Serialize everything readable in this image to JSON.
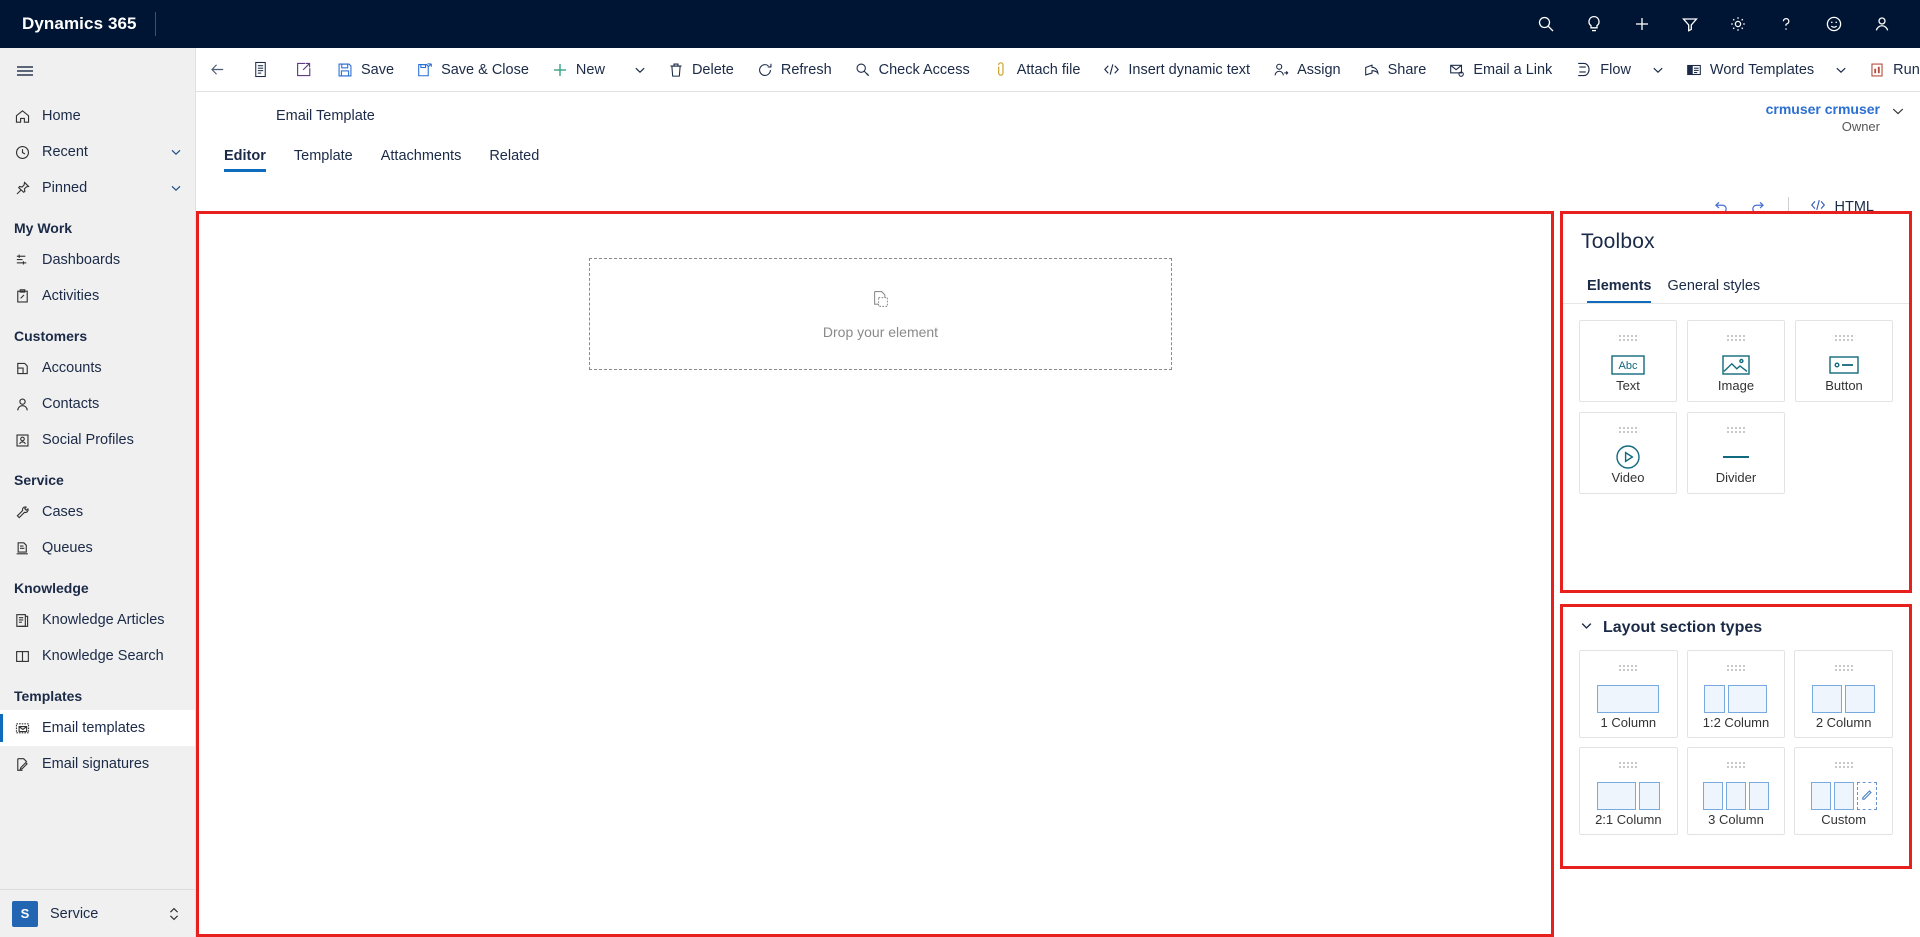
{
  "topbar": {
    "brand": "Dynamics 365",
    "icons": [
      {
        "name": "search-icon",
        "label": "Search"
      },
      {
        "name": "lightbulb-icon",
        "label": "Tips"
      },
      {
        "name": "plus-icon",
        "label": "New"
      },
      {
        "name": "filter-icon",
        "label": "Filter"
      },
      {
        "name": "gear-icon",
        "label": "Settings"
      },
      {
        "name": "question-icon",
        "label": "Help"
      },
      {
        "name": "smiley-icon",
        "label": "Feedback"
      },
      {
        "name": "person-icon",
        "label": "Account"
      }
    ]
  },
  "commandbar": {
    "items": [
      {
        "name": "back-button",
        "label": "",
        "icon": "arrow-left-icon"
      },
      {
        "name": "form-selector-button",
        "label": "",
        "icon": "form-icon"
      },
      {
        "name": "open-new-window-button",
        "label": "",
        "icon": "open-external-icon"
      },
      {
        "name": "save-button",
        "label": "Save",
        "icon": "save-icon"
      },
      {
        "name": "save-and-close-button",
        "label": "Save & Close",
        "icon": "save-close-icon"
      },
      {
        "name": "new-button",
        "label": "New",
        "icon": "plus-icon"
      },
      {
        "name": "new-overflow-caret",
        "label": "",
        "icon": "chevron-down-icon"
      },
      {
        "name": "delete-button",
        "label": "Delete",
        "icon": "trash-icon"
      },
      {
        "name": "refresh-button",
        "label": "Refresh",
        "icon": "refresh-icon"
      },
      {
        "name": "check-access-button",
        "label": "Check Access",
        "icon": "key-icon"
      },
      {
        "name": "attach-file-button",
        "label": "Attach file",
        "icon": "paperclip-icon"
      },
      {
        "name": "insert-dynamic-text-button",
        "label": "Insert dynamic text",
        "icon": "code-icon"
      },
      {
        "name": "assign-button",
        "label": "Assign",
        "icon": "assign-person-icon"
      },
      {
        "name": "share-button",
        "label": "Share",
        "icon": "share-icon"
      },
      {
        "name": "email-a-link-button",
        "label": "Email a Link",
        "icon": "email-link-icon"
      },
      {
        "name": "flow-button",
        "label": "Flow",
        "icon": "flow-icon"
      },
      {
        "name": "flow-caret",
        "label": "",
        "icon": "chevron-down-icon"
      },
      {
        "name": "word-templates-button",
        "label": "Word Templates",
        "icon": "word-icon"
      },
      {
        "name": "word-templates-caret",
        "label": "",
        "icon": "chevron-down-icon"
      },
      {
        "name": "run-report-button",
        "label": "Run Report",
        "icon": "report-icon"
      },
      {
        "name": "run-report-caret",
        "label": "",
        "icon": "chevron-down-icon"
      }
    ]
  },
  "sidebar": {
    "hamburger": "site-map-toggle",
    "items": [
      {
        "name": "sidebar-item-home",
        "label": "Home",
        "icon": "home-icon",
        "type": "item",
        "caret": false,
        "selected": false
      },
      {
        "name": "sidebar-item-recent",
        "label": "Recent",
        "icon": "clock-icon",
        "type": "item",
        "caret": true,
        "selected": false
      },
      {
        "name": "sidebar-item-pinned",
        "label": "Pinned",
        "icon": "pin-icon",
        "type": "item",
        "caret": true,
        "selected": false
      },
      {
        "name": "sidebar-group-my-work",
        "label": "My Work",
        "type": "group"
      },
      {
        "name": "sidebar-item-dashboards",
        "label": "Dashboards",
        "icon": "dashboard-icon",
        "type": "item",
        "caret": false,
        "selected": false
      },
      {
        "name": "sidebar-item-activities",
        "label": "Activities",
        "icon": "clipboard-icon",
        "type": "item",
        "caret": false,
        "selected": false
      },
      {
        "name": "sidebar-group-customers",
        "label": "Customers",
        "type": "group"
      },
      {
        "name": "sidebar-item-accounts",
        "label": "Accounts",
        "icon": "account-icon",
        "type": "item",
        "caret": false,
        "selected": false
      },
      {
        "name": "sidebar-item-contacts",
        "label": "Contacts",
        "icon": "contact-icon",
        "type": "item",
        "caret": false,
        "selected": false
      },
      {
        "name": "sidebar-item-social-profiles",
        "label": "Social Profiles",
        "icon": "social-profile-icon",
        "type": "item",
        "caret": false,
        "selected": false
      },
      {
        "name": "sidebar-group-service",
        "label": "Service",
        "type": "group"
      },
      {
        "name": "sidebar-item-cases",
        "label": "Cases",
        "icon": "case-icon",
        "type": "item",
        "caret": false,
        "selected": false
      },
      {
        "name": "sidebar-item-queues",
        "label": "Queues",
        "icon": "queue-icon",
        "type": "item",
        "caret": false,
        "selected": false
      },
      {
        "name": "sidebar-group-knowledge",
        "label": "Knowledge",
        "type": "group"
      },
      {
        "name": "sidebar-item-knowledge-articles",
        "label": "Knowledge Articles",
        "icon": "article-icon",
        "type": "item",
        "caret": false,
        "selected": false
      },
      {
        "name": "sidebar-item-knowledge-search",
        "label": "Knowledge Search",
        "icon": "book-icon",
        "type": "item",
        "caret": false,
        "selected": false
      },
      {
        "name": "sidebar-group-templates",
        "label": "Templates",
        "type": "group"
      },
      {
        "name": "sidebar-item-email-templates",
        "label": "Email templates",
        "icon": "email-template-icon",
        "type": "item",
        "caret": false,
        "selected": true
      },
      {
        "name": "sidebar-item-email-signatures",
        "label": "Email signatures",
        "icon": "signature-icon",
        "type": "item",
        "caret": false,
        "selected": false
      }
    ],
    "area_switcher": {
      "badge": "S",
      "label": "Service"
    }
  },
  "record": {
    "title": "Email Template",
    "owner_name": "crmuser crmuser",
    "owner_role": "Owner"
  },
  "tabs": [
    {
      "name": "tab-editor",
      "label": "Editor",
      "active": true
    },
    {
      "name": "tab-template",
      "label": "Template",
      "active": false
    },
    {
      "name": "tab-attachments",
      "label": "Attachments",
      "active": false
    },
    {
      "name": "tab-related",
      "label": "Related",
      "active": false
    }
  ],
  "editor_tools": {
    "undo_label": "Undo",
    "redo_label": "Redo",
    "html_label": "HTML"
  },
  "canvas": {
    "dropzone_label": "Drop your element"
  },
  "toolbox": {
    "title": "Toolbox",
    "tabs": [
      {
        "name": "toolbox-tab-elements",
        "label": "Elements",
        "active": true
      },
      {
        "name": "toolbox-tab-general-styles",
        "label": "General styles",
        "active": false
      }
    ],
    "elements": [
      {
        "name": "toolbox-element-text",
        "label": "Text",
        "icon": "abc-icon"
      },
      {
        "name": "toolbox-element-image",
        "label": "Image",
        "icon": "image-icon"
      },
      {
        "name": "toolbox-element-button",
        "label": "Button",
        "icon": "button-icon"
      },
      {
        "name": "toolbox-element-video",
        "label": "Video",
        "icon": "play-circle-icon"
      },
      {
        "name": "toolbox-element-divider",
        "label": "Divider",
        "icon": "divider-icon"
      }
    ]
  },
  "layout_sections": {
    "title": "Layout section types",
    "expanded": true,
    "items": [
      {
        "name": "layout-1-column",
        "label": "1 Column",
        "cols": [
          1
        ]
      },
      {
        "name": "layout-1-2-column",
        "label": "1:2 Column",
        "cols": [
          1,
          2
        ]
      },
      {
        "name": "layout-2-column",
        "label": "2 Column",
        "cols": [
          1,
          1
        ]
      },
      {
        "name": "layout-2-1-column",
        "label": "2:1 Column",
        "cols": [
          2,
          1
        ]
      },
      {
        "name": "layout-3-column",
        "label": "3 Column",
        "cols": [
          1,
          1,
          1
        ]
      },
      {
        "name": "layout-custom",
        "label": "Custom",
        "cols": [
          1,
          1,
          "edit"
        ]
      }
    ]
  },
  "colors": {
    "brand_navy": "#001433",
    "accent_blue": "#0f6cbd",
    "highlight_red": "#e8201d",
    "toolbox_icon_teal": "#11697e",
    "owner_link": "#2b6fd1"
  }
}
